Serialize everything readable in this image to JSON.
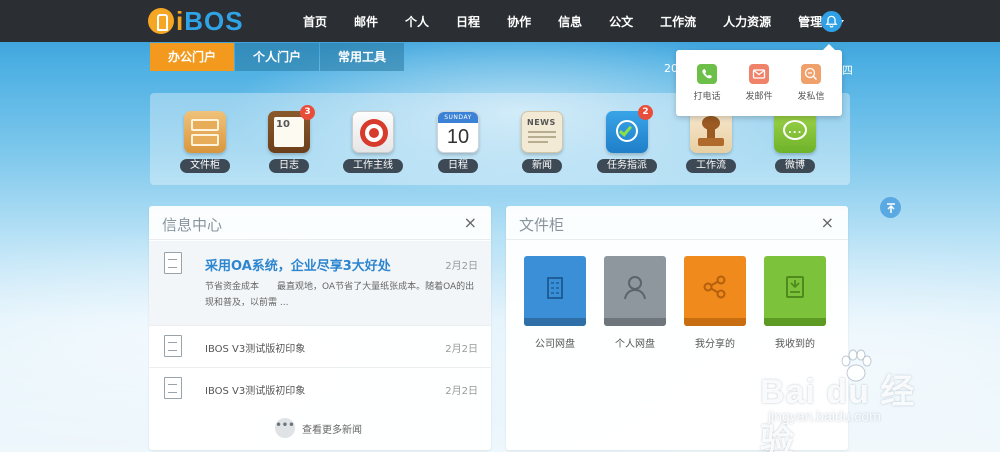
{
  "logo": {
    "text_i": "i",
    "text_bos": "BOS"
  },
  "nav": {
    "items": [
      "首页",
      "邮件",
      "个人",
      "日程",
      "协作",
      "信息",
      "公文",
      "工作流",
      "人力资源"
    ],
    "user_label": "管理员"
  },
  "portal_tabs": [
    {
      "label": "办公门户",
      "active": true
    },
    {
      "label": "个人门户",
      "active": false
    },
    {
      "label": "常用工具",
      "active": false
    }
  ],
  "date_fragment_left": "20",
  "date_fragment_right": "四",
  "quick_apps": [
    {
      "label": "文件柜",
      "icon": "file-cabinet-icon"
    },
    {
      "label": "日志",
      "icon": "diary-icon",
      "badge": "3",
      "page_number": "10"
    },
    {
      "label": "工作主线",
      "icon": "target-icon"
    },
    {
      "label": "日程",
      "icon": "calendar-icon",
      "calendar_weekday": "SUNDAY",
      "calendar_day": "10"
    },
    {
      "label": "新闻",
      "icon": "news-icon",
      "news_word": "NEWS"
    },
    {
      "label": "任务指派",
      "icon": "task-check-icon",
      "badge": "2"
    },
    {
      "label": "工作流",
      "icon": "stamp-icon"
    },
    {
      "label": "微博",
      "icon": "chat-bubble-icon"
    }
  ],
  "popup": {
    "items": [
      {
        "label": "打电话",
        "icon": "phone-icon",
        "color": "#6cc04a"
      },
      {
        "label": "发邮件",
        "icon": "mail-icon",
        "color": "#f0826a"
      },
      {
        "label": "发私信",
        "icon": "message-icon",
        "color": "#f0a06a"
      }
    ]
  },
  "info_center": {
    "title": "信息中心",
    "close": "×",
    "featured": {
      "headline": "采用OA系统，企业尽享3大好处",
      "date": "2月2日",
      "summary": "节省资金成本　　最直观地，OA节省了大量纸张成本。随着OA的出现和普及，以前需 ..."
    },
    "rows": [
      {
        "text": "IBOS V3测试版初印象",
        "date": "2月2日"
      },
      {
        "text": "IBOS V3测试版初印象",
        "date": "2月2日"
      }
    ],
    "more_dots": "•••",
    "more_label": "查看更多新闻"
  },
  "file_cabinet": {
    "title": "文件柜",
    "close": "×",
    "items": [
      {
        "label": "公司网盘",
        "icon": "building-icon",
        "color": "#3b8fd6",
        "bar": "#2f6fa8"
      },
      {
        "label": "个人网盘",
        "icon": "person-icon",
        "color": "#8e979e",
        "bar": "#6e767c"
      },
      {
        "label": "我分享的",
        "icon": "share-icon",
        "color": "#f08a1c",
        "bar": "#c86e10"
      },
      {
        "label": "我收到的",
        "icon": "received-icon",
        "color": "#7cc23a",
        "bar": "#5c9a24"
      }
    ]
  },
  "watermark": {
    "main": "Bai du 经验",
    "sub": "jingyan.baidu.com"
  },
  "colors": {
    "accent_orange": "#f39a1e",
    "brand_blue": "#2fa3e6",
    "topbar": "#2b2f33",
    "link_blue": "#2c86cf"
  }
}
